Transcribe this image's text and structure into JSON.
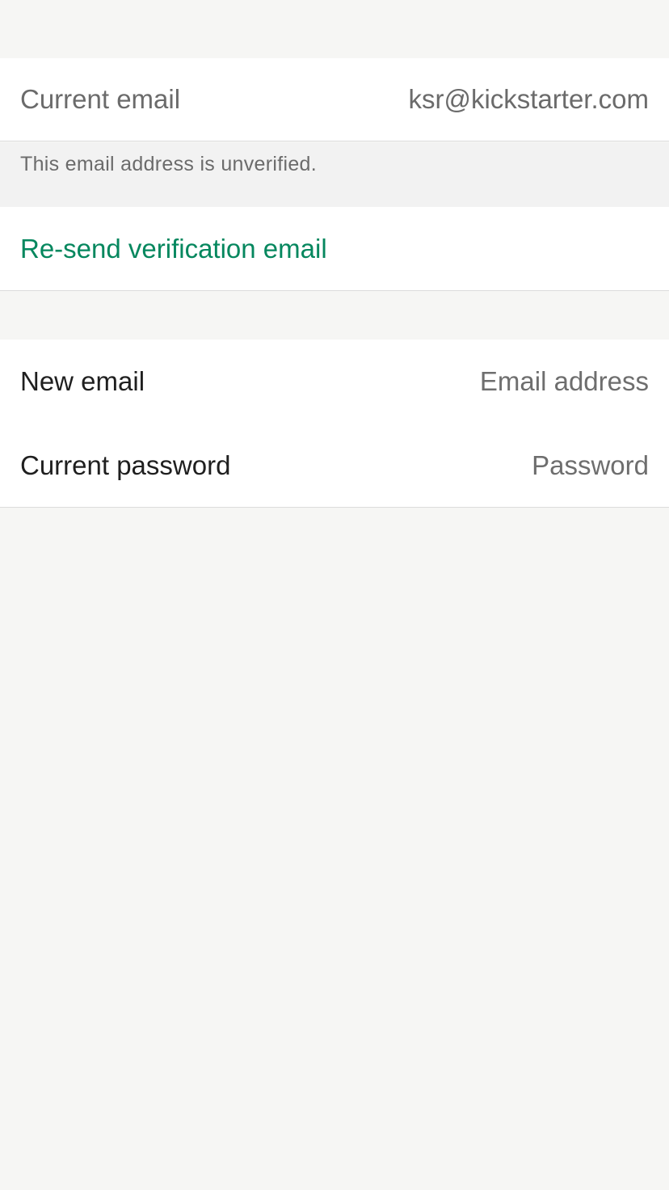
{
  "current_email": {
    "label": "Current email",
    "value": "ksr@kickstarter.com"
  },
  "verification": {
    "note": "This email address is unverified.",
    "resend_label": "Re-send verification email"
  },
  "form": {
    "new_email": {
      "label": "New email",
      "value": "",
      "placeholder": "Email address"
    },
    "current_password": {
      "label": "Current password",
      "value": "",
      "placeholder": "Password"
    }
  },
  "colors": {
    "accent": "#05875e",
    "background": "#f6f6f4",
    "card": "#ffffff",
    "muted_text": "#6b6b6b"
  }
}
